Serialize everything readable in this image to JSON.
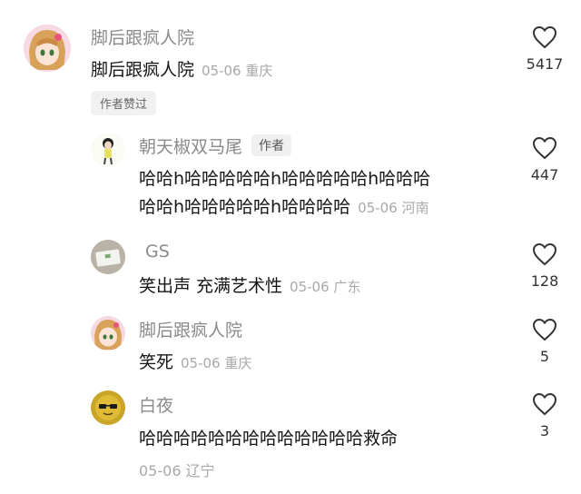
{
  "comments": [
    {
      "username": "脚后跟疯人院",
      "text": "脚后跟疯人院",
      "date": "05-06",
      "location": "重庆",
      "likes": "5417",
      "liked_badge": "作者赞过"
    },
    {
      "username": "朝天椒双马尾",
      "author_tag": "作者",
      "text_lines": [
        "哈哈h哈哈哈哈哈h哈哈哈哈哈h哈哈哈",
        "哈哈h哈哈哈哈哈h哈哈哈哈"
      ],
      "date": "05-06",
      "location": "河南",
      "likes": "447"
    },
    {
      "username": "GS",
      "text": "笑出声 充满艺术性",
      "date": "05-06",
      "location": "广东",
      "likes": "128"
    },
    {
      "username": "脚后跟疯人院",
      "text": "笑死",
      "date": "05-06",
      "location": "重庆",
      "likes": "5"
    },
    {
      "username": "白夜",
      "text": "哈哈哈哈哈哈哈哈哈哈哈哈哈救命",
      "date": "05-06",
      "location": "辽宁",
      "likes": "3"
    }
  ],
  "colors": {
    "username": "#8a8a8a",
    "meta": "#a8a8a8",
    "text": "#161616"
  },
  "icons": {
    "like": "heart-outline-icon"
  }
}
